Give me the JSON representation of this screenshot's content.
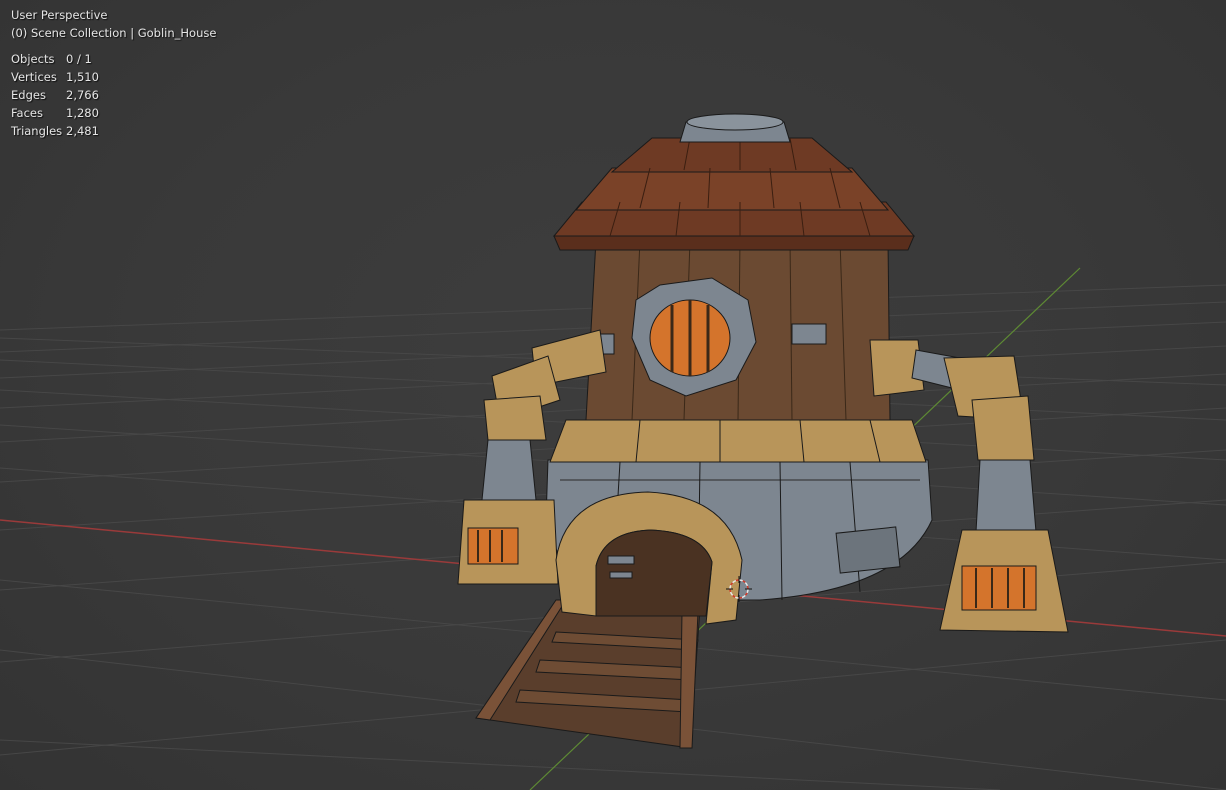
{
  "viewport": {
    "view_name": "User Perspective",
    "collection_line": "(0) Scene Collection | Goblin_House",
    "axis_colors": {
      "x": "#b0403f",
      "y": "#6a9a3a"
    },
    "grid_color": "#4a4a4a"
  },
  "statistics": [
    {
      "label": "Objects",
      "value": "0 / 1"
    },
    {
      "label": "Vertices",
      "value": "1,510"
    },
    {
      "label": "Edges",
      "value": "2,766"
    },
    {
      "label": "Faces",
      "value": "1,280"
    },
    {
      "label": "Triangles",
      "value": "2,481"
    }
  ],
  "model": {
    "icon": "goblin-house-model",
    "colors": {
      "roof": "#6e3a24",
      "wood": "#6b4a32",
      "metal": "#7d8690",
      "trim": "#b8955a",
      "glow": "#d4742c"
    }
  },
  "cursor_icon": "3d-cursor-icon"
}
